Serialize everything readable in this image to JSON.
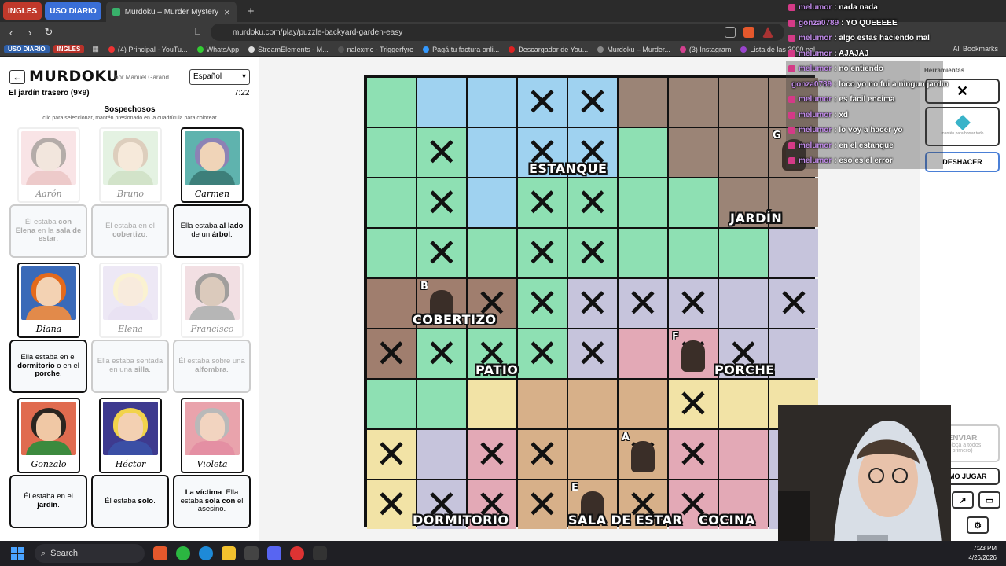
{
  "browser": {
    "pinned_tabs": [
      "INGLES",
      "USO DIARIO"
    ],
    "active_tab_title": "Murdoku – Murder Mystery me",
    "url": "murdoku.com/play/puzzle-backyard-garden-easy",
    "bookmarks_pills": [
      "USO DIARIO",
      "INGLES"
    ],
    "bookmarks": [
      "(4) Principal - YouTu...",
      "WhatsApp",
      "StreamElements - M...",
      "nalexmc - Triggerfyre",
      "Pagá tu factura onli...",
      "Descargador de You...",
      "Murdoku – Murder...",
      "(3) Instagram",
      "Lista de las 3000 pal..."
    ],
    "all_bookmarks": "All Bookmarks"
  },
  "game": {
    "logo": "MURDOKU",
    "author": "por Manuel Garand",
    "language": "Español",
    "puzzle_title": "El jardín trasero (9×9)",
    "timer": "7:22",
    "suspects_title": "Sospechosos",
    "suspects_sub": "clic para seleccionar, mantén presionado en la cuadrícula para colorear"
  },
  "suspects": [
    {
      "name": "Aarón",
      "clue_html": "Él estaba <b>con Elena</b> en la <b>sala de estar</b>.",
      "state": "dim",
      "skin": "#e3c9b4",
      "hair": "#5a4a42",
      "shirt": "#d98c8c",
      "bg": "#f2c5c8"
    },
    {
      "name": "Bruno",
      "clue_html": "Él estaba en el <b>cobertizo</b>.",
      "state": "dim",
      "skin": "#eccfae",
      "hair": "#b5946e",
      "shirt": "#9cc28a",
      "bg": "#c5e3c0"
    },
    {
      "name": "Carmen",
      "clue_html": "Ella estaba <b>al lado</b> de un <b>árbol</b>.",
      "state": "active",
      "skin": "#f0d4b8",
      "hair": "#8c82b5",
      "shirt": "#3d7f7a",
      "bg": "#5fb3ae"
    },
    {
      "name": "Diana",
      "clue_html": "Ella estaba en el <b>dormitorio</b> o en el <b>porche</b>.",
      "state": "active",
      "skin": "#f3d2b3",
      "hair": "#e46a1c",
      "shirt": "#e28a4a",
      "bg": "#3a6ab8"
    },
    {
      "name": "Elena",
      "clue_html": "Ella estaba sentada en una <b>silla</b>.",
      "state": "dim",
      "skin": "#f0d3b6",
      "hair": "#f4e39a",
      "shirt": "#cfc1e5",
      "bg": "#d9cdea"
    },
    {
      "name": "Francisco",
      "clue_html": "Él estaba sobre una <b>alfombra</b>.",
      "state": "dim",
      "skin": "#b08b6c",
      "hair": "#2e2a26",
      "shirt": "#5e5e5e",
      "bg": "#e3b9c2"
    },
    {
      "name": "Gonzalo",
      "clue_html": "Él estaba en el <b>jardín</b>.",
      "state": "active",
      "skin": "#f0c8a5",
      "hair": "#2b2520",
      "shirt": "#3c8a3e",
      "bg": "#e06b4f"
    },
    {
      "name": "Héctor",
      "clue_html": "Él estaba <b>solo</b>.",
      "state": "active",
      "skin": "#f3d0b2",
      "hair": "#f2d34b",
      "shirt": "#3b4fa5",
      "bg": "#3e3a8f"
    },
    {
      "name": "Violeta",
      "clue_html": "<b>La víctima</b>. Ella estaba <b>sola con</b> el asesino.",
      "state": "active",
      "skin": "#f2d4c0",
      "hair": "#b9b9b9",
      "shirt": "#e48fa3",
      "bg": "#e9a3ac"
    }
  ],
  "board": {
    "rooms": [
      "ESTANQUE",
      "JARDÍN",
      "COBERTIZO",
      "PATIO",
      "PORCHE",
      "DORMITORIO",
      "SALA DE ESTAR",
      "COCINA"
    ],
    "grid": [
      [
        "g",
        "w",
        "w",
        "w",
        "w",
        "p",
        "p",
        "p",
        "p"
      ],
      [
        "g",
        "g",
        "w",
        "w",
        "w",
        "g",
        "p",
        "p",
        "p"
      ],
      [
        "g",
        "g",
        "w",
        "g",
        "g",
        "g",
        "g",
        "p",
        "p"
      ],
      [
        "g",
        "g",
        "g",
        "g",
        "g",
        "g",
        "g",
        "g",
        "u"
      ],
      [
        "s",
        "s",
        "s",
        "g",
        "u",
        "u",
        "u",
        "u",
        "u"
      ],
      [
        "s",
        "g",
        "g",
        "g",
        "u",
        "k",
        "k",
        "u",
        "u"
      ],
      [
        "g",
        "g",
        "y",
        "b",
        "b",
        "b",
        "y",
        "y",
        "y"
      ],
      [
        "y",
        "u",
        "r",
        "b",
        "b",
        "b",
        "r",
        "r",
        "u"
      ],
      [
        "y",
        "u",
        "r",
        "b",
        "b",
        "b",
        "r",
        "r",
        "u"
      ]
    ],
    "x_marks": [
      "0,3",
      "0,4",
      "1,1",
      "1,3",
      "1,4",
      "2,1",
      "2,3",
      "2,4",
      "3,1",
      "3,3",
      "3,4",
      "4,2",
      "4,3",
      "4,4",
      "4,5",
      "4,6",
      "4,8",
      "5,0",
      "5,1",
      "5,2",
      "5,3",
      "5,4",
      "5,6",
      "5,7",
      "6,6",
      "7,0",
      "7,2",
      "7,3",
      "7,5",
      "7,6",
      "8,0",
      "8,1",
      "8,2",
      "8,3",
      "8,5",
      "8,6"
    ],
    "letters": [
      {
        "letter": "G",
        "cell": "1,8"
      },
      {
        "letter": "B",
        "cell": "4,1"
      },
      {
        "letter": "F",
        "cell": "5,6"
      },
      {
        "letter": "A",
        "cell": "7,5"
      },
      {
        "letter": "E",
        "cell": "8,4"
      }
    ]
  },
  "tools": {
    "title": "Herramientas",
    "erase_hint": "mantén para borrar todo",
    "undo": "DESHACER",
    "submit": "ENVIAR",
    "submit_sub": "(coloca a todos primero)",
    "how_to": "CÓMO JUGAR",
    "help": "?"
  },
  "chat": [
    {
      "user": "melumor",
      "text": "nada nada"
    },
    {
      "user": "gonza0789",
      "text": "YO QUEEEEE"
    },
    {
      "user": "melumor",
      "text": "algo estas haciendo mal"
    },
    {
      "user": "melumor",
      "text": "AJAJAJ"
    },
    {
      "user": "melumor",
      "text": "no entiendo"
    },
    {
      "user": "gonza0789",
      "text": "loco yo no fui a ningun jardin"
    },
    {
      "user": "melumor",
      "text": "es facil encima"
    },
    {
      "user": "melumor",
      "text": "xd"
    },
    {
      "user": "melumor",
      "text": "lo voy a hacer yo"
    },
    {
      "user": "melumor",
      "text": "en el estanque"
    },
    {
      "user": "melumor",
      "text": "eso es el error"
    }
  ],
  "taskbar": {
    "search": "Search",
    "time": "7:23 PM",
    "date": "4/26/2026"
  },
  "colors": {
    "grass": "#8ee0b3",
    "water": "#9fd2f0",
    "path": "#9b8476",
    "shed": "#a07e6e",
    "purple": "#c6c4dc",
    "yellow": "#f2e3a6",
    "brown": "#d7b089",
    "pink": "#e3a9b6",
    "undo_border": "#4a7fd6"
  }
}
